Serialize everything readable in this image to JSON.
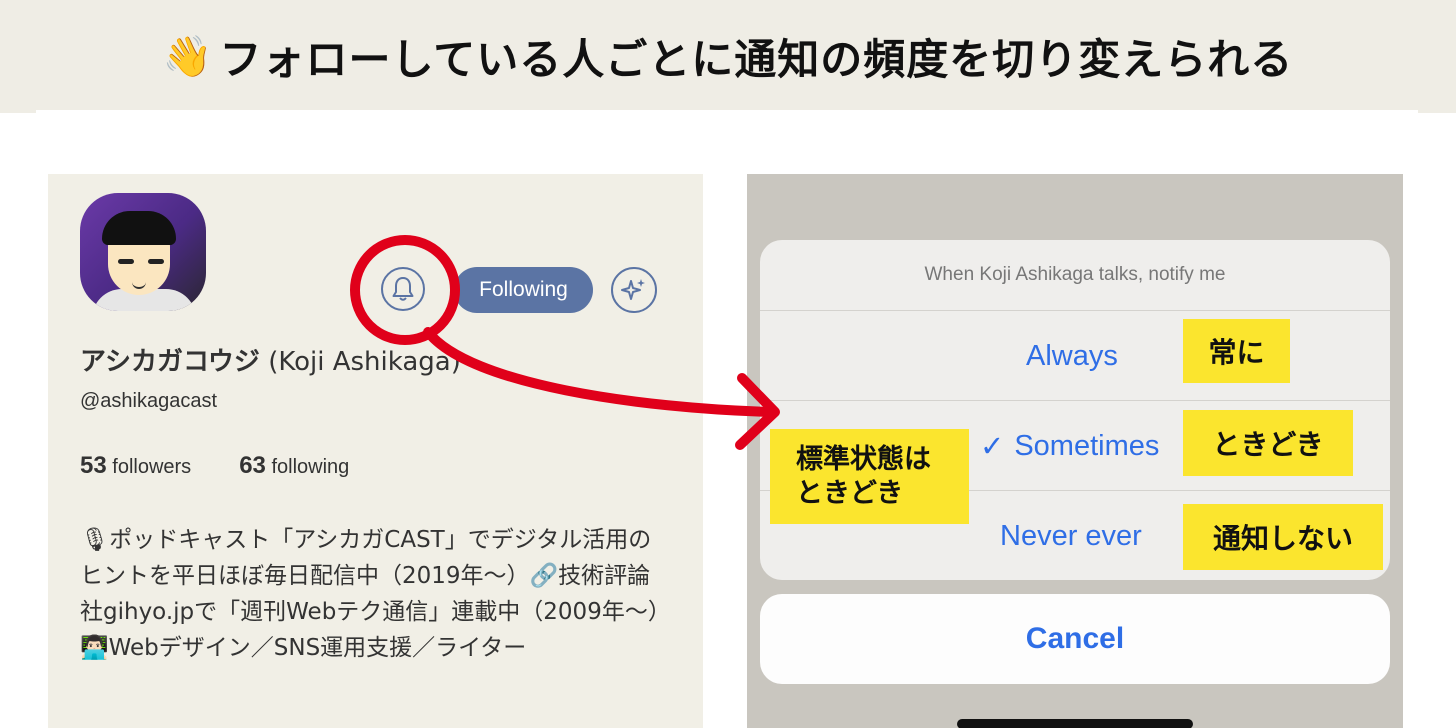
{
  "banner": {
    "emoji": "👋",
    "title": "フォローしている人ごとに通知の頻度を切り変えられる"
  },
  "profile": {
    "display_name_jp": "アシカガコウジ",
    "display_name_en": "(Koji Ashikaga)",
    "handle": "@ashikagacast",
    "followers_count": "53",
    "followers_label": "followers",
    "following_count": "63",
    "following_label": "following",
    "bio": "🎙ポッドキャスト「アシカガCAST」でデジタル活用のヒントを平日ほぼ毎日配信中（2019年〜）🔗技術評論社gihyo.jpで「週刊Webテク通信」連載中（2009年〜）👨🏻‍💻Webデザイン／SNS運用支援／ライター",
    "following_button": "Following",
    "bell_icon": "bell-icon",
    "sparkle_icon": "sparkle-icon"
  },
  "sheet": {
    "header": "When Koji Ashikaga talks, notify me",
    "options": [
      {
        "label": "Always",
        "selected": false
      },
      {
        "label": "Sometimes",
        "selected": true
      },
      {
        "label": "Never ever",
        "selected": false
      }
    ],
    "check_mark": "✓",
    "cancel": "Cancel"
  },
  "annotations": {
    "always": "常に",
    "sometimes": "ときどき",
    "never": "通知しない",
    "default_line1": "標準状態は",
    "default_line2": "ときどき"
  },
  "colors": {
    "banner_bg": "#efede5",
    "panel_bg": "#f1efe6",
    "accent_blue": "#5b74a4",
    "ios_blue": "#2f6ee6",
    "highlight_yellow": "#fbe52e",
    "annotation_red": "#e0001a"
  }
}
